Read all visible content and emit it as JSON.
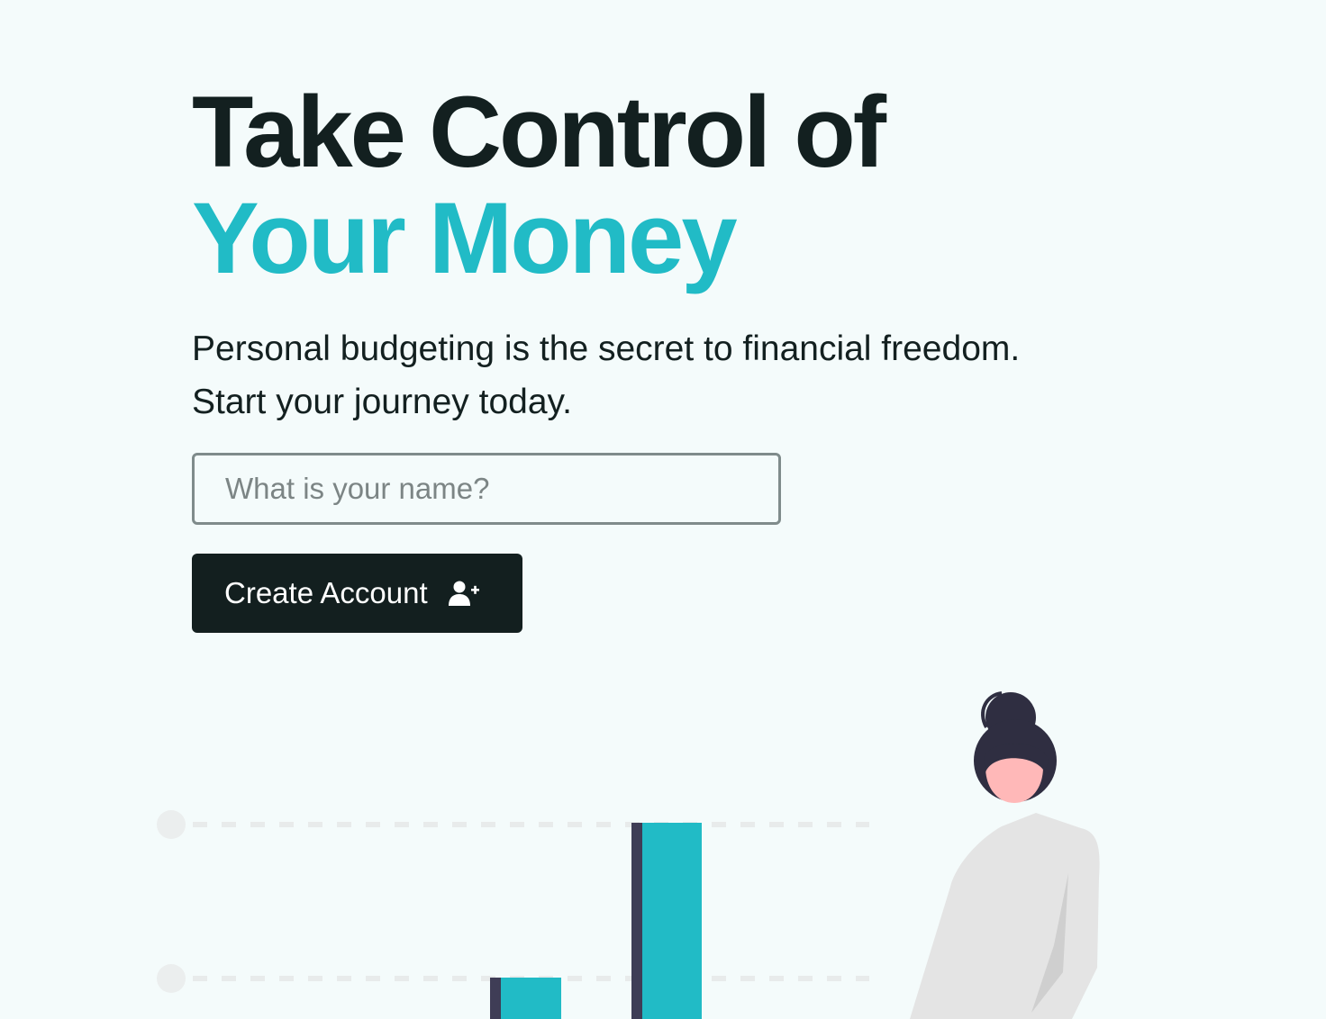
{
  "hero": {
    "title_line1": "Take Control of",
    "title_line2": "Your Money",
    "subtitle_line1": "Personal budgeting is the secret to financial freedom.",
    "subtitle_line2": "Start your journey today."
  },
  "form": {
    "name_placeholder": "What is your name?",
    "name_value": "",
    "create_button_label": "Create Account",
    "create_button_icon": "user-plus-icon"
  },
  "colors": {
    "background": "#f4fbfb",
    "text": "#132020",
    "accent": "#21bbc6",
    "button_bg": "#131f1f",
    "input_border": "#7f8b8b"
  }
}
